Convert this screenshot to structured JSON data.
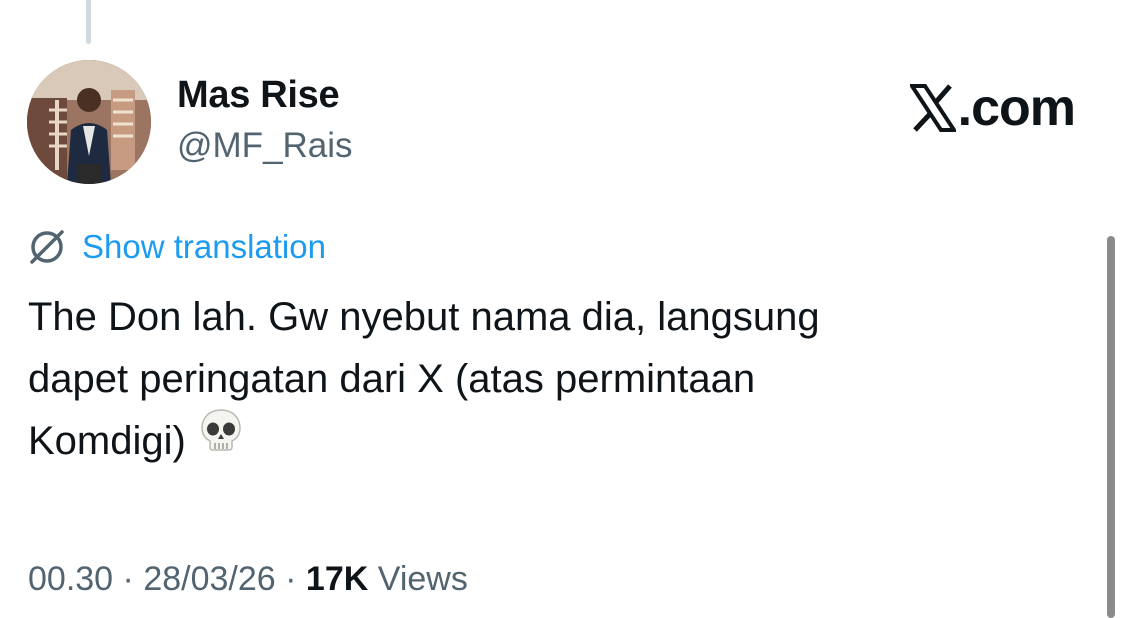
{
  "author": {
    "display_name": "Mas Rise",
    "handle": "@MF_Rais"
  },
  "brand": {
    "text": ".com",
    "logo_icon": "x-logo-icon"
  },
  "translation": {
    "label": "Show translation",
    "icon": "globe-strike-icon",
    "color": "#1d9bf0"
  },
  "tweet": {
    "lines": [
      "The Don lah. Gw nyebut nama dia, langsung",
      "dapet peringatan dari X (atas permintaan",
      "Komdigi)"
    ],
    "emoji": "skull-emoji"
  },
  "meta": {
    "time": "00.30",
    "separator": "·",
    "date": "28/03/26",
    "view_count": "17K",
    "views_label": "Views"
  },
  "colors": {
    "text_primary": "#0f1419",
    "text_secondary": "#536471",
    "link": "#1d9bf0"
  }
}
